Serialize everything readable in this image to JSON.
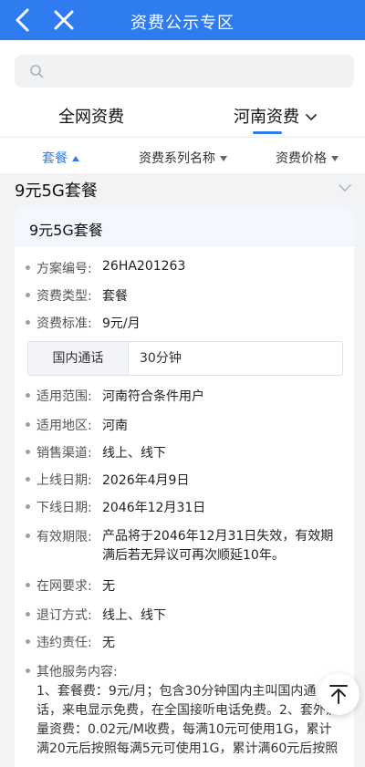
{
  "header": {
    "title": "资费公示专区"
  },
  "search": {
    "placeholder": ""
  },
  "region_tabs": [
    {
      "label": "全网资费"
    },
    {
      "label": "河南资费"
    }
  ],
  "sort_bar": [
    {
      "label": "套餐"
    },
    {
      "label": "资费系列名称"
    },
    {
      "label": "资费价格"
    }
  ],
  "group": {
    "title": "9元5G套餐"
  },
  "card": {
    "title": "9元5G套餐",
    "fields": [
      {
        "label": "方案编号:",
        "value": "26HA201263"
      },
      {
        "label": "资费类型:",
        "value": "套餐"
      },
      {
        "label": "资费标准:",
        "value": "9元/月"
      },
      {
        "label": "适用范围:",
        "value": "河南符合条件用户"
      },
      {
        "label": "适用地区:",
        "value": "河南"
      },
      {
        "label": "销售渠道:",
        "value": "线上、线下"
      },
      {
        "label": "上线日期:",
        "value": "2026年4月9日"
      },
      {
        "label": "下线日期:",
        "value": "2046年12月31日"
      },
      {
        "label": "有效期限:",
        "value": "产品将于2046年12月31日失效，有效期满后若无异议可再次顺延10年。"
      },
      {
        "label": "在网要求:",
        "value": "无"
      },
      {
        "label": "退订方式:",
        "value": "线上、线下"
      },
      {
        "label": "违约责任:",
        "value": "无"
      }
    ],
    "voice": {
      "label": "国内通话",
      "value": "30分钟"
    },
    "other_label": "其他服务内容:",
    "other_text": "1、套餐费：9元/月；包含30分钟国内主叫国内通话，来电显示免费，在全国接听电话免费。2、套外流量资费：0.02元/M收费，每满10元可使用1G，累计满20元后按照每满5元可使用1G，累计满60元后按照"
  },
  "colors": {
    "accent": "#2f7bf0"
  }
}
